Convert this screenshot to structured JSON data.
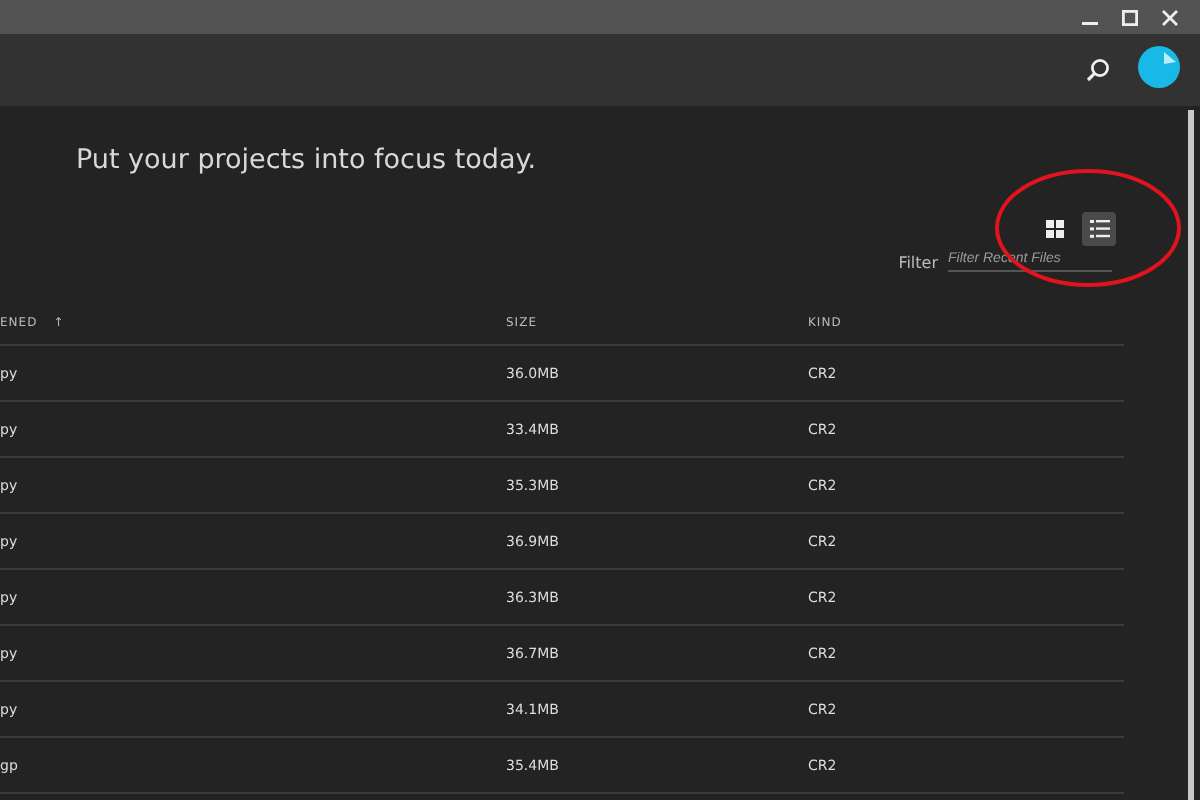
{
  "window": {
    "controls": [
      {
        "kind": "minimize"
      },
      {
        "kind": "maximize"
      },
      {
        "kind": "close"
      }
    ]
  },
  "headline": "Put your projects into focus today.",
  "view_toggle": [
    {
      "kind": "grid",
      "selected": false
    },
    {
      "kind": "list",
      "selected": true
    }
  ],
  "filter": {
    "label": "Filter",
    "placeholder": "Filter Recent Files"
  },
  "table": {
    "columns": [
      {
        "label": "ENED",
        "sort": "↑"
      },
      {
        "label": "SIZE"
      },
      {
        "label": "KIND"
      }
    ],
    "rows": [
      [
        "py",
        "36.0MB",
        "CR2"
      ],
      [
        "py",
        "33.4MB",
        "CR2"
      ],
      [
        "py",
        "35.3MB",
        "CR2"
      ],
      [
        "py",
        "36.9MB",
        "CR2"
      ],
      [
        "py",
        "36.3MB",
        "CR2"
      ],
      [
        "py",
        "36.7MB",
        "CR2"
      ],
      [
        "py",
        "34.1MB",
        "CR2"
      ],
      [
        "gp",
        "35.4MB",
        "CR2"
      ]
    ]
  },
  "annotations": [
    {
      "kind": "ellipse"
    }
  ]
}
